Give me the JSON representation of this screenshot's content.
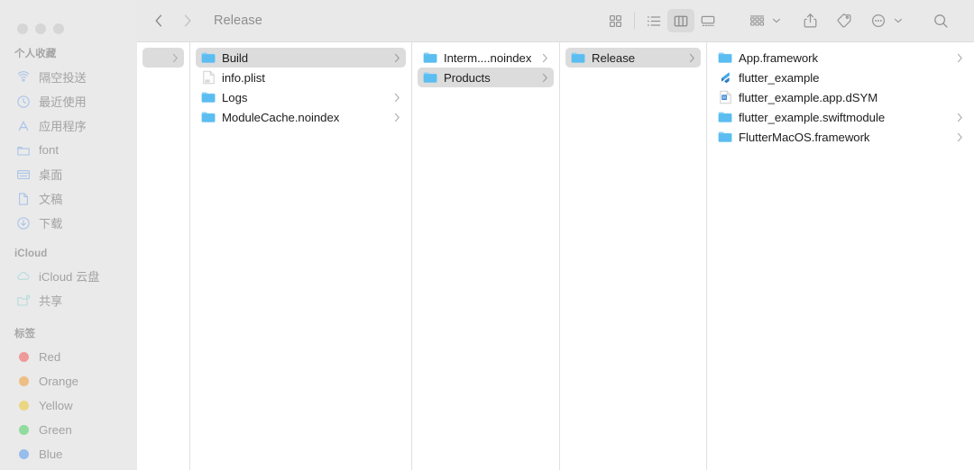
{
  "window": {
    "title": "Release",
    "traffic_lights": [
      "close",
      "minimize",
      "zoom"
    ]
  },
  "toolbar": {
    "back_label": "Back",
    "forward_label": "Forward",
    "view_icon_label": "Icon View",
    "view_list_label": "List View",
    "view_column_label": "Column View",
    "view_gallery_label": "Gallery View",
    "group_label": "Group",
    "share_label": "Share",
    "tags_label": "Tags",
    "more_label": "More",
    "search_label": "Search",
    "active_view": "column"
  },
  "sidebar": {
    "sections": [
      {
        "title": "个人收藏",
        "items": [
          {
            "label": "隔空投送",
            "icon": "airdrop-icon"
          },
          {
            "label": "最近使用",
            "icon": "clock-icon"
          },
          {
            "label": "应用程序",
            "icon": "applications-icon"
          },
          {
            "label": "font",
            "icon": "folder-icon"
          },
          {
            "label": "桌面",
            "icon": "desktop-icon"
          },
          {
            "label": "文稿",
            "icon": "document-icon"
          },
          {
            "label": "下载",
            "icon": "downloads-icon"
          }
        ]
      },
      {
        "title": "iCloud",
        "items": [
          {
            "label": "iCloud 云盘",
            "icon": "cloud-icon"
          },
          {
            "label": "共享",
            "icon": "shared-folder-icon"
          }
        ]
      },
      {
        "title": "标签",
        "items": [
          {
            "label": "Red",
            "icon": "tag-dot",
            "color": "#ef9a9a"
          },
          {
            "label": "Orange",
            "icon": "tag-dot",
            "color": "#efbe85"
          },
          {
            "label": "Yellow",
            "icon": "tag-dot",
            "color": "#ebd684"
          },
          {
            "label": "Green",
            "icon": "tag-dot",
            "color": "#8fdc9e"
          },
          {
            "label": "Blue",
            "icon": "tag-dot",
            "color": "#96bdec"
          }
        ]
      }
    ]
  },
  "columns": [
    {
      "name": "column-partial",
      "rows": [
        {
          "label": "",
          "icon": "none",
          "selected": true,
          "chevron": true
        }
      ]
    },
    {
      "name": "column-build",
      "rows": [
        {
          "label": "Build",
          "icon": "folder-icon",
          "selected": true,
          "chevron": true
        },
        {
          "label": "info.plist",
          "icon": "plist-icon",
          "selected": false,
          "chevron": false
        },
        {
          "label": "Logs",
          "icon": "folder-icon",
          "selected": false,
          "chevron": true
        },
        {
          "label": "ModuleCache.noindex",
          "icon": "folder-icon",
          "selected": false,
          "chevron": true
        }
      ]
    },
    {
      "name": "column-products",
      "rows": [
        {
          "label": "Interm....noindex",
          "icon": "folder-icon",
          "selected": false,
          "chevron": true
        },
        {
          "label": "Products",
          "icon": "folder-icon",
          "selected": true,
          "chevron": true
        }
      ]
    },
    {
      "name": "column-release",
      "rows": [
        {
          "label": "Release",
          "icon": "folder-icon",
          "selected": true,
          "chevron": true
        }
      ]
    },
    {
      "name": "column-contents",
      "rows": [
        {
          "label": "App.framework",
          "icon": "folder-icon",
          "selected": false,
          "chevron": true
        },
        {
          "label": "flutter_example",
          "icon": "flutter-icon",
          "selected": false,
          "chevron": false
        },
        {
          "label": "flutter_example.app.dSYM",
          "icon": "dsym-icon",
          "selected": false,
          "chevron": false
        },
        {
          "label": "flutter_example.swiftmodule",
          "icon": "folder-icon",
          "selected": false,
          "chevron": true
        },
        {
          "label": "FlutterMacOS.framework",
          "icon": "folder-icon",
          "selected": false,
          "chevron": true
        }
      ]
    }
  ],
  "colors": {
    "folder_blue": "#55bef0",
    "sidebar_bg": "#eaeaea",
    "toolbar_bg": "#e9e9e9",
    "selection_gray": "#dcdcdc",
    "flutter_blue": "#42a5f5"
  }
}
